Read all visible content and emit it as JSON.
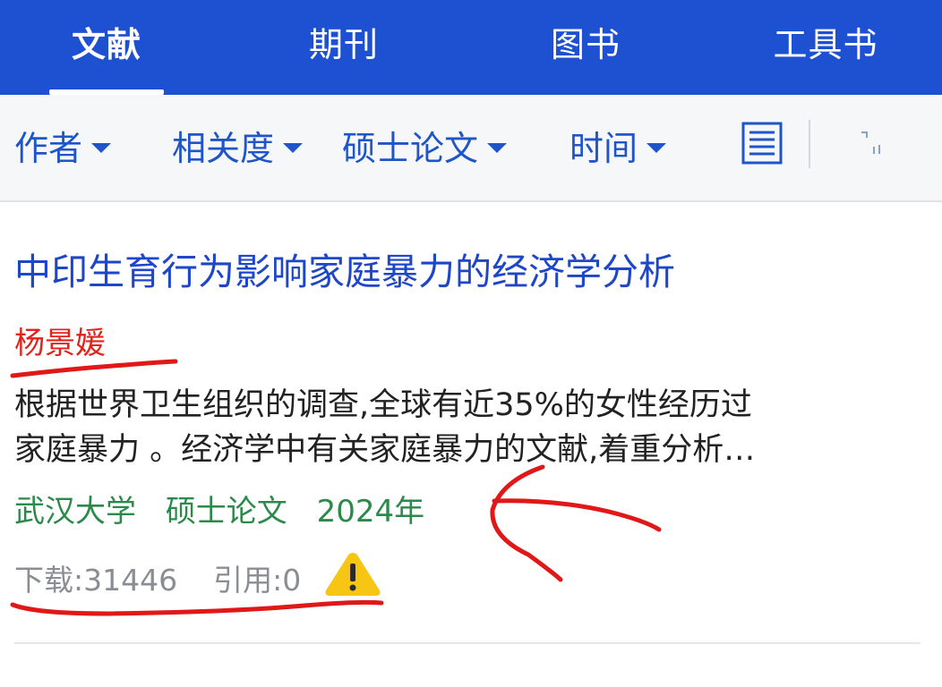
{
  "tabs": [
    {
      "label": "文献",
      "active": true
    },
    {
      "label": "期刊",
      "active": false
    },
    {
      "label": "图书",
      "active": false
    },
    {
      "label": "工具书",
      "active": false
    }
  ],
  "filters": [
    {
      "label": "作者"
    },
    {
      "label": "相关度"
    },
    {
      "label": "硕士论文"
    },
    {
      "label": "时间"
    }
  ],
  "toolbar_icons": [
    "list-view-icon",
    "grid-view-icon"
  ],
  "result": {
    "title": "中印生育行为影响家庭暴力的经济学分析",
    "author": "杨景媛",
    "abstract_lines": [
      "根据世界卫生组织的调查,全球有近35%的女性经历过",
      "家庭暴力 。经济学中有关家庭暴力的文献,着重分析…"
    ],
    "institution": "武汉大学",
    "doc_type": "硕士论文",
    "year": "2024年",
    "downloads_label": "下载:31446",
    "citations_label": "引用:0",
    "warning_icon": "warning-icon"
  },
  "colors": {
    "header_bg": "#1e50d2",
    "link_blue": "#1e46c8",
    "author_red": "#e0241b",
    "meta_green": "#2a8a4a",
    "annotation_red": "#e01818",
    "warning_yellow": "#f7c614"
  }
}
